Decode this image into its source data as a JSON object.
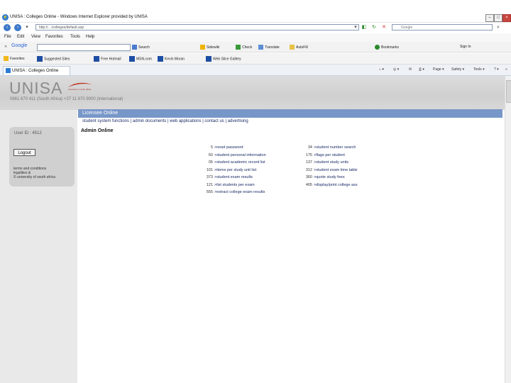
{
  "window": {
    "title": "UNISA : Colleges Online - Windows Internet Explorer provided by UNISA"
  },
  "address": {
    "url": "http://…/colleges/default.asp",
    "live_search": "Google"
  },
  "menu": [
    "File",
    "Edit",
    "View",
    "Favorites",
    "Tools",
    "Help"
  ],
  "google_toolbar": {
    "brand": "Google",
    "items": [
      "Search",
      "Sidewiki",
      "Check",
      "Translate",
      "AutoFill"
    ],
    "right_items": [
      "Bookmarks",
      "Sign In"
    ]
  },
  "favorites": {
    "label": "Favorites",
    "items": [
      "Suggested Sites",
      "Free Hotmail",
      "MSN.com",
      "Kevin Moran",
      "Web Slice Gallery"
    ]
  },
  "tab": {
    "label": "UNISA : Colleges Online"
  },
  "commands": [
    "Page",
    "Safety",
    "Tools"
  ],
  "site": {
    "logo": "UNISA",
    "logo_sub": "university of south africa",
    "contact": "0861 670 411 (South Africa) +27 11 670 9000 (International)",
    "user_id": "User ID : 4512",
    "logout": "Logout",
    "terms": [
      "terms and conditions",
      "legalities &",
      "© university of south africa"
    ],
    "section_title": "Licensee Online",
    "nav": "student system functions | admin documents | web applications | contact us | advertising",
    "admin_title": "Admin Online"
  },
  "links_left": [
    {
      "num": "5",
      "label": "reset password"
    },
    {
      "num": "60",
      "label": "student personal information"
    },
    {
      "num": "05",
      "label": "student academic record list"
    },
    {
      "num": "101",
      "label": "items per study unit list"
    },
    {
      "num": "373",
      "label": "student exam results"
    },
    {
      "num": "121",
      "label": "list students per exam"
    },
    {
      "num": "555",
      "label": "extract college exam results"
    }
  ],
  "links_right": [
    {
      "num": "34",
      "label": "student number search"
    },
    {
      "num": "175",
      "label": "flags per student"
    },
    {
      "num": "137",
      "label": "student study units"
    },
    {
      "num": "312",
      "label": "student exam time table"
    },
    {
      "num": "360",
      "label": "quote study fees"
    },
    {
      "num": "405",
      "label": "display/print college ass"
    }
  ]
}
